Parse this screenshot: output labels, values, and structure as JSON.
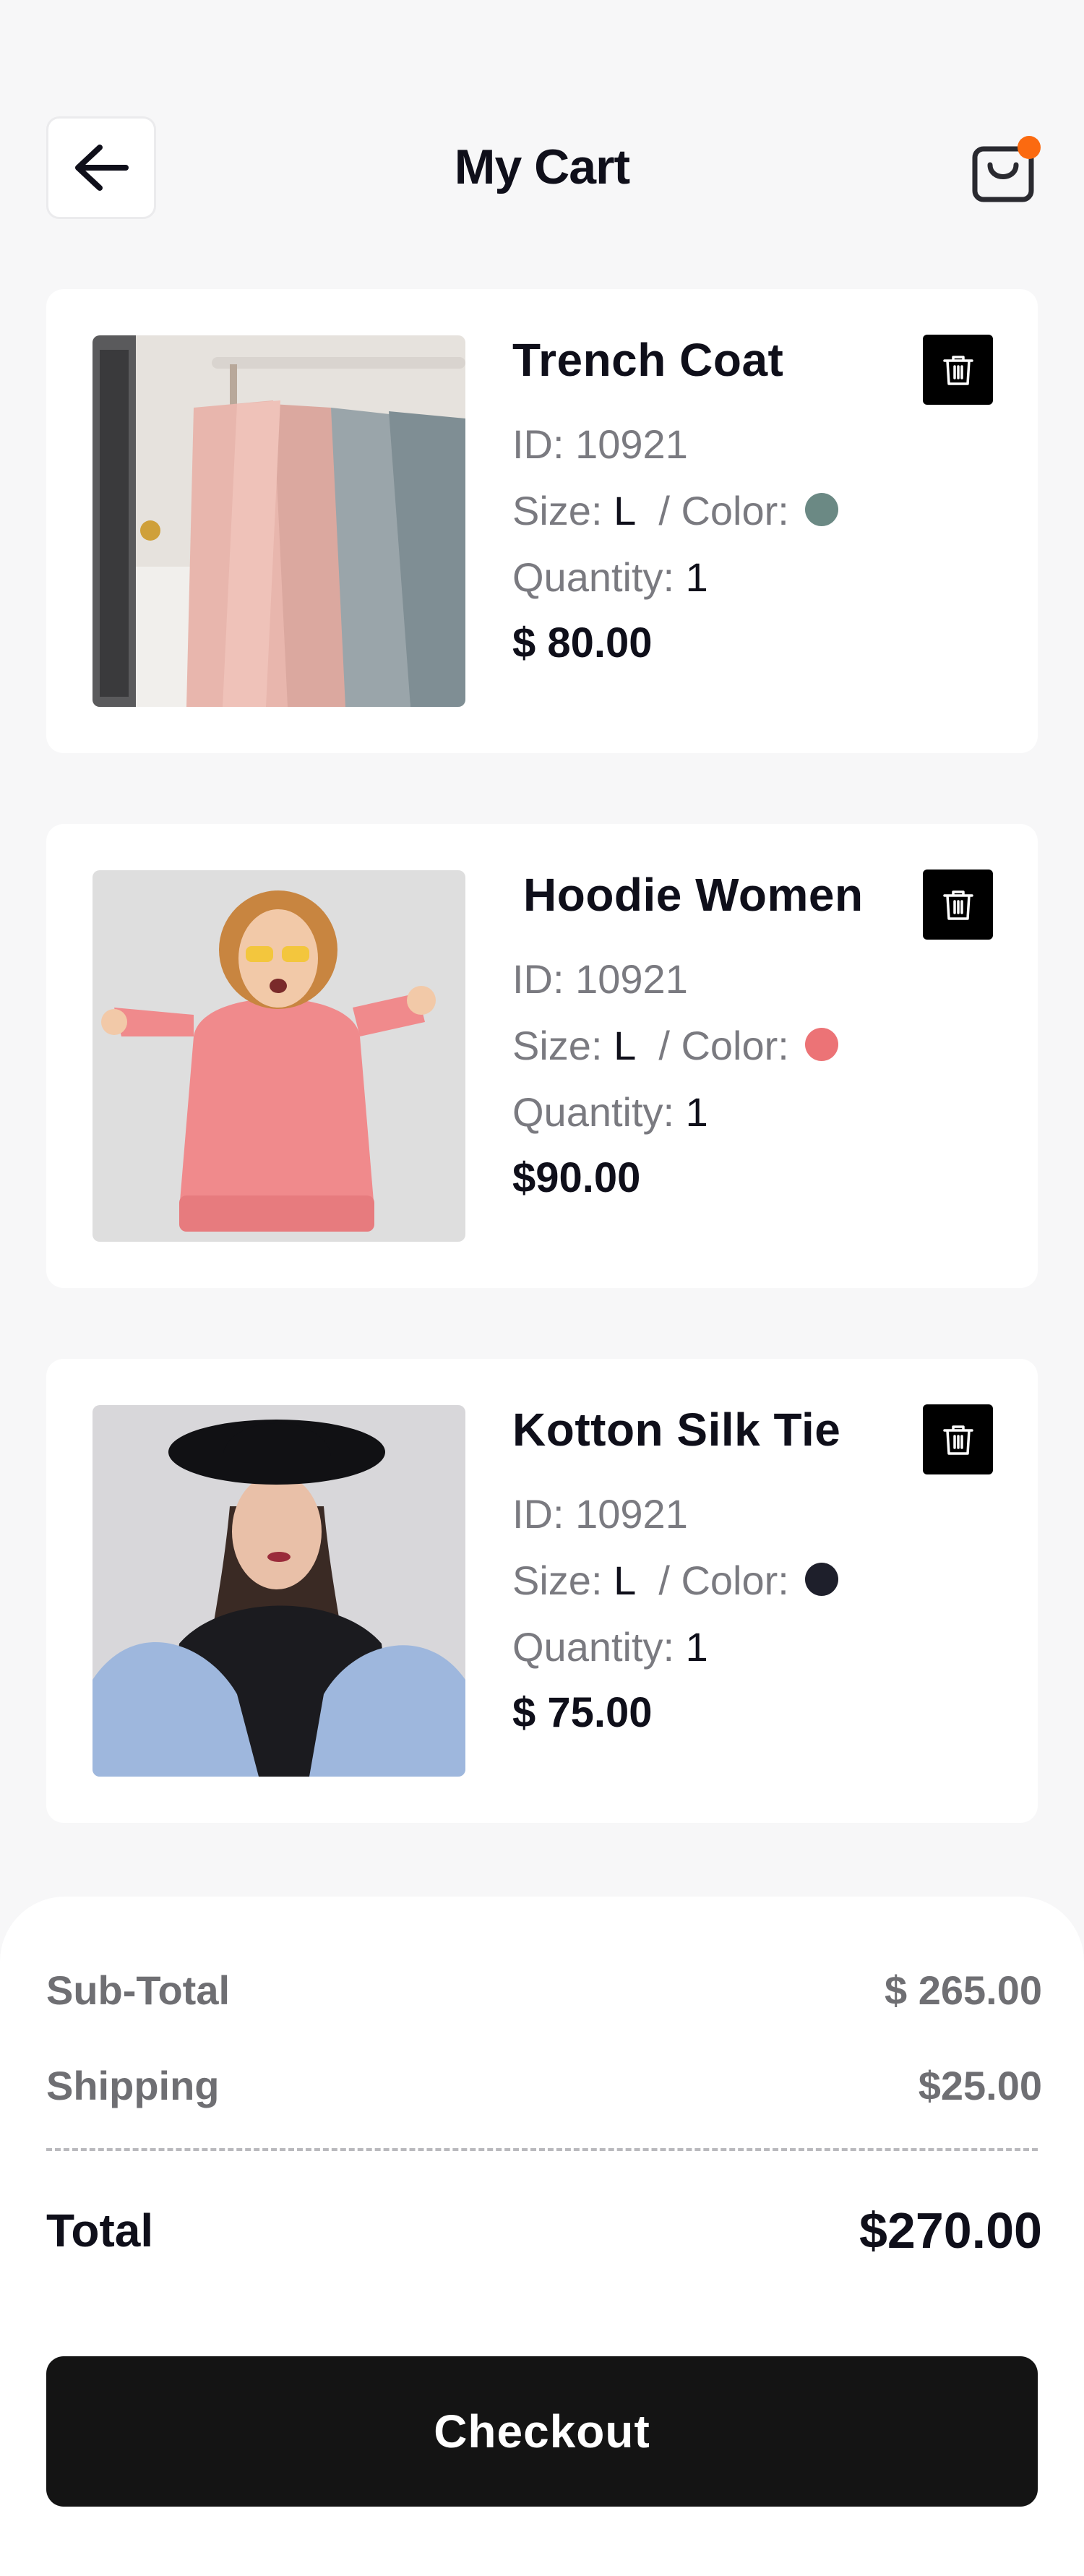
{
  "header": {
    "title": "My Cart",
    "back_icon": "arrow-left-icon",
    "cart_icon": "shopping-bag-icon",
    "notification_color": "#fb6a10"
  },
  "cart": {
    "items": [
      {
        "name": "Trench Coat",
        "id_label": "ID:",
        "id": "10921",
        "size_label": "Size:",
        "size": "L",
        "color_label": "/ Color:",
        "color": "#6b8984",
        "qty_label": "Quantity:",
        "qty": "1",
        "price": "$ 80.00"
      },
      {
        "name": "Hoodie Women",
        "id_label": "ID:",
        "id": "10921",
        "size_label": "Size:",
        "size": "L",
        "color_label": "/ Color:",
        "color": "#ec7376",
        "qty_label": "Quantity:",
        "qty": "1",
        "price": "$90.00"
      },
      {
        "name": "Kotton Silk Tie",
        "id_label": "ID:",
        "id": "10921",
        "size_label": "Size:",
        "size": "L",
        "color_label": "/ Color:",
        "color": "#1e1f2b",
        "qty_label": "Quantity:",
        "qty": "1",
        "price": "$ 75.00"
      }
    ]
  },
  "summary": {
    "subtotal_label": "Sub-Total",
    "subtotal": "$ 265.00",
    "shipping_label": "Shipping",
    "shipping": "$25.00",
    "total_label": "Total",
    "total": "$270.00"
  },
  "checkout": {
    "label": "Checkout"
  }
}
